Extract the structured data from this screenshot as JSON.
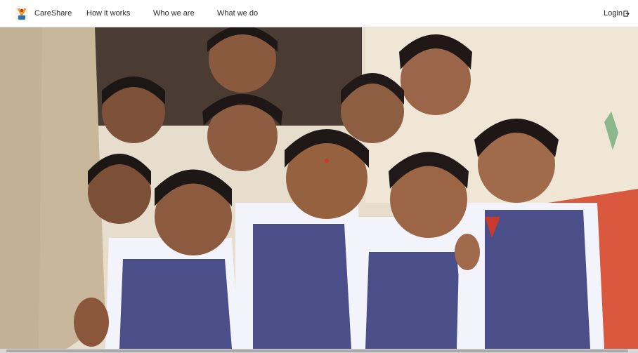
{
  "nav": {
    "brand": "CareShare",
    "links": [
      "How it works",
      "Who we are",
      "What we do"
    ],
    "login_label": "Login",
    "login_icon": "login-icon"
  },
  "hero": {
    "image_icon": "children-photo"
  },
  "colors": {
    "accent_red": "#c83a2c",
    "uniform_navy": "#4a4f8a",
    "uniform_white": "#f3f4fb"
  }
}
